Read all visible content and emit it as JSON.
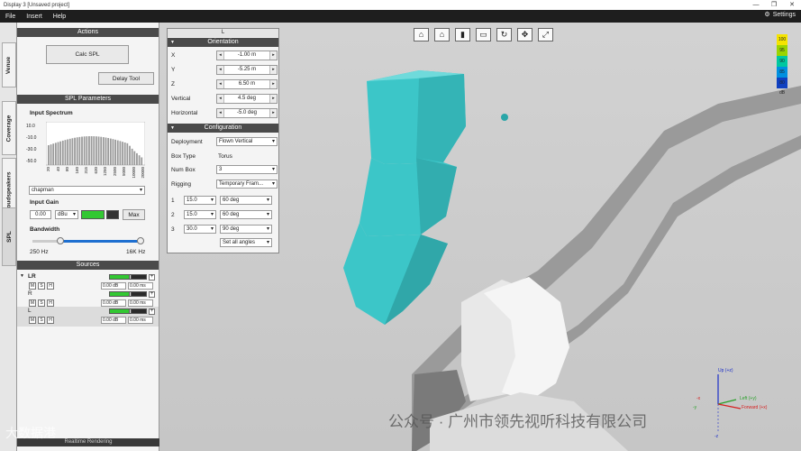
{
  "window": {
    "title": "Display 3 [Unsaved project]",
    "minimize": "—",
    "restore": "❐",
    "close": "✕"
  },
  "menu": {
    "file": "File",
    "insert": "Insert",
    "help": "Help",
    "settings": "Settings"
  },
  "sidetabs": [
    "Venue",
    "Coverage",
    "Loudspeakers",
    "SPL"
  ],
  "actions": {
    "header": "Actions",
    "calc_spl": "Calc SPL",
    "delay_tool": "Delay Tool"
  },
  "spl_params": {
    "header": "SPL Parameters",
    "input_spectrum": "Input Spectrum",
    "y_ticks": [
      "10.0",
      "-10.0",
      "-30.0",
      "-50.0"
    ],
    "x_ticks": [
      "20",
      "40",
      "80",
      "160",
      "315",
      "630",
      "1250",
      "2500",
      "5000",
      "10000",
      "20000"
    ],
    "spectrum_preset": "chapman",
    "input_gain": "Input Gain",
    "gain_value": "0.00",
    "gain_unit": "dBu",
    "max": "Max",
    "bandwidth": "Bandwidth",
    "bw_low": "250 Hz",
    "bw_high": "16K Hz"
  },
  "sources": {
    "header": "Sources",
    "items": [
      {
        "name": "LR",
        "db": "0.00 dB",
        "ms": "0.00 ms",
        "level": 0.55
      },
      {
        "name": "R",
        "db": "0.00 dB",
        "ms": "0.00 ms",
        "level": 0.55
      },
      {
        "name": "L",
        "db": "0.00 dB",
        "ms": "0.00 ms",
        "level": 0.55
      }
    ],
    "m": "M",
    "s": "S",
    "h": "H"
  },
  "bottom_label": "Realtime Rendering",
  "props": {
    "title": "L",
    "orientation_header": "Orientation",
    "x_label": "X",
    "x_value": "-1.00 m",
    "y_label": "Y",
    "y_value": "-5.25 m",
    "z_label": "Z",
    "z_value": "6.50 m",
    "vertical_label": "Vertical",
    "vertical_value": "4.5 deg",
    "horizontal_label": "Horizontal",
    "horizontal_value": "-5.0 deg",
    "config_header": "Configuration",
    "deployment_label": "Deployment",
    "deployment_value": "Flown Vertical",
    "boxtype_label": "Box Type",
    "boxtype_value": "Torus",
    "numbox_label": "Num Box",
    "numbox_value": "3",
    "rigging_label": "Rigging",
    "rigging_value": "Temporary Fram...",
    "boxes": [
      {
        "idx": "1",
        "angle": "15.0",
        "dispersion": "60 deg"
      },
      {
        "idx": "2",
        "angle": "15.0",
        "dispersion": "60 deg"
      },
      {
        "idx": "3",
        "angle": "30.0",
        "dispersion": "90 deg"
      }
    ],
    "set_all_angles": "Set all angles"
  },
  "toolbar": {
    "icons": [
      "perspective-icon",
      "home-icon",
      "front-view-icon",
      "top-view-icon",
      "rotate-icon",
      "pan-icon",
      "fit-icon"
    ],
    "glyphs": [
      "⌂",
      "⌂",
      "▮",
      "▭",
      "↻",
      "✥",
      "⤢"
    ]
  },
  "legend": {
    "values": [
      "100",
      "95",
      "90",
      "85",
      "80"
    ],
    "unit": "dB",
    "colors": [
      "#f5e400",
      "#9bd400",
      "#00c8a0",
      "#0090e0",
      "#1040c0"
    ]
  },
  "axes": {
    "up": "Up (+z)",
    "left": "Left (+y)",
    "forward": "Forward (+x)",
    "neg_x": "-x",
    "neg_y": "-y",
    "neg_z": "-z"
  },
  "watermark": {
    "right": "公众号 · 广州市领先视听科技有限公司",
    "left": "大数据港"
  },
  "colors": {
    "speaker": "#3cc6c8",
    "menubar": "#1e1e1e",
    "header": "#4a4a4a",
    "meter_green": "#32c832"
  }
}
